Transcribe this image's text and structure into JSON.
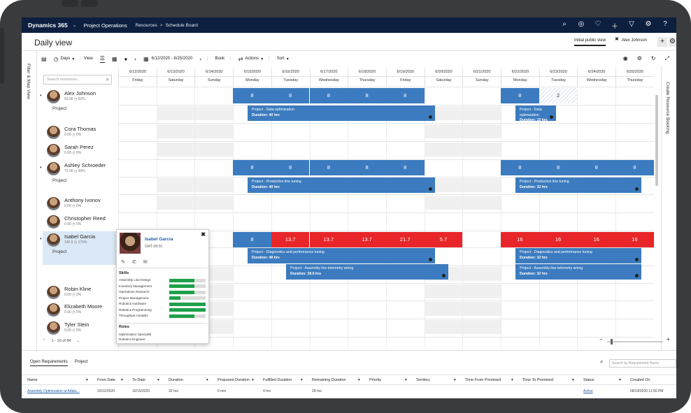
{
  "topbar": {
    "brand": "Dynamics 365",
    "app": "Project Operations",
    "breadcrumb": [
      "Resources",
      "Schedule Board"
    ],
    "icons": [
      "search-icon",
      "target-icon",
      "lightbulb-icon",
      "plus-icon",
      "filter-icon",
      "gear-icon",
      "help-icon"
    ]
  },
  "header": {
    "title": "Daily view",
    "tabs": [
      "Initial public view",
      "Alex Johnson"
    ],
    "add_label": "+"
  },
  "left_rail": {
    "label": "Filter & Map View"
  },
  "toolbar": {
    "days_label": "Days",
    "view_label": "View",
    "date_range": "6/12/2020 - 6/25/2020",
    "book_label": "Book",
    "actions_label": "Actions",
    "sort_label": "Sort"
  },
  "search": {
    "placeholder": "Search resources..."
  },
  "days": [
    {
      "date": "6/12/2020",
      "weekday": "Friday"
    },
    {
      "date": "6/13/2020",
      "weekday": "Saturday"
    },
    {
      "date": "6/14/2020",
      "weekday": "Sunday"
    },
    {
      "date": "6/15/2020",
      "weekday": "Monday"
    },
    {
      "date": "6/16/2020",
      "weekday": "Tuesday"
    },
    {
      "date": "6/17/2020",
      "weekday": "Wednesday"
    },
    {
      "date": "6/18/2020",
      "weekday": "Thursday"
    },
    {
      "date": "6/19/2020",
      "weekday": "Friday"
    },
    {
      "date": "6/20/2020",
      "weekday": "Saturday"
    },
    {
      "date": "6/21/2020",
      "weekday": "Sunday"
    },
    {
      "date": "6/22/2020",
      "weekday": "Monday"
    },
    {
      "date": "6/23/2020",
      "weekday": "Tuesday"
    },
    {
      "date": "6/24/2020",
      "weekday": "Wednesday"
    },
    {
      "date": "6/25/2020",
      "weekday": "Thursday"
    }
  ],
  "resources": [
    {
      "name": "Alex Johnson",
      "hours": "50.00",
      "pct": "62%",
      "expanded": true,
      "sub": "Project"
    },
    {
      "name": "Cora Thomas",
      "hours": "0.00",
      "pct": "0%"
    },
    {
      "name": "Sarah Perez",
      "hours": "0.00",
      "pct": "0%"
    },
    {
      "name": "Ashley Schroeder",
      "hours": "72.00",
      "pct": "90%",
      "expanded": true,
      "sub": "Project"
    },
    {
      "name": "Anthony Ivonov",
      "hours": "0.00",
      "pct": "0%"
    },
    {
      "name": "Christopher Reed",
      "hours": "0.00",
      "pct": "0%"
    },
    {
      "name": "Isabel Garcia",
      "hours": "140.5",
      "pct": "176%",
      "expanded": true,
      "sub": "Project"
    },
    {
      "name": "Robin Kline",
      "hours": "0.00",
      "pct": "0%"
    },
    {
      "name": "Elizabeth Moore",
      "hours": "0.00",
      "pct": "0%"
    },
    {
      "name": "Tyler Stein",
      "hours": "0.00",
      "pct": "0%"
    }
  ],
  "capacity": {
    "alex": [
      "8",
      "8",
      "8",
      "8",
      "8",
      "8",
      "2"
    ],
    "ashley": [
      "8",
      "8",
      "8",
      "8",
      "8",
      "8",
      "8",
      "8",
      "8"
    ],
    "isabel": [
      "8",
      "13.7",
      "13.7",
      "13.7",
      "21.7",
      "5.7",
      "16",
      "16",
      "16",
      "16"
    ]
  },
  "bookings": [
    {
      "title": "Project - Data optimization",
      "duration": "Duration: 40 hrs"
    },
    {
      "title": "Project - Data optimization",
      "duration": "Duration: 10 hrs"
    },
    {
      "title": "Project - Production line tuning",
      "duration": "Duration: 40 hrs"
    },
    {
      "title": "Project - Production line tuning",
      "duration": "Duration: 32 hrs"
    },
    {
      "title": "Project - Diagnostics and performance tuning",
      "duration": "Duration: 48 hrs"
    },
    {
      "title": "Project - Diagnostics and performance tuning",
      "duration": "Duration: 32 hrs"
    },
    {
      "title": "Project - Assembly line telemetry wiring",
      "duration": "Duration: 28.6 hrs"
    },
    {
      "title": "Project - Assembly line telemetry wiring",
      "duration": "Duration: 32 hrs"
    }
  ],
  "popover": {
    "name": "Isabel Garcia",
    "timezone": "GMT-08:00",
    "skills_heading": "Skills",
    "skills": [
      {
        "name": "Assembly Line Design",
        "level": 0.7
      },
      {
        "name": "Inventory Management",
        "level": 0.7
      },
      {
        "name": "Operations Research",
        "level": 0.7
      },
      {
        "name": "Project Management",
        "level": 0.3
      },
      {
        "name": "Robotics Hardware",
        "level": 1.0
      },
      {
        "name": "Robotics Programming",
        "level": 1.0
      },
      {
        "name": "Throughput Analysis",
        "level": 0.7
      }
    ],
    "roles_heading": "Roles",
    "roles": [
      "Optimization Specialist",
      "Robotics Engineer"
    ]
  },
  "pager": {
    "label": "1 - 10 of 84"
  },
  "right_rail": {
    "label": "Create Resource Booking"
  },
  "lower": {
    "tabs": [
      "Open Requirements",
      "Project"
    ],
    "search_placeholder": "Search by Requirement Name",
    "columns": [
      "Name",
      "From Date",
      "To Date",
      "Duration",
      "Proposed Duration",
      "Fulfilled Duration",
      "Remaining Duration",
      "Priority",
      "Territory",
      "Time From Promised",
      "Time To Promised",
      "Status",
      "Created On"
    ],
    "row": [
      "Assembly Optimization at Adatu...",
      "10/12/2020",
      "10/15/2020",
      "32 hrs",
      "0 min",
      "4 hrs",
      "28 hrs",
      "",
      "",
      "",
      "",
      "Active",
      "08/14/2020 11:56 PM"
    ]
  }
}
